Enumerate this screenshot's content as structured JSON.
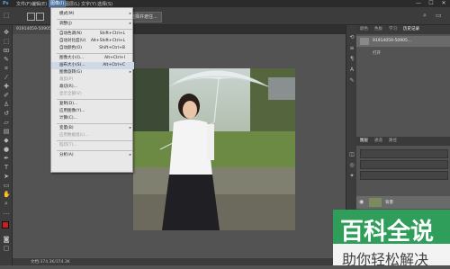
{
  "menubar": {
    "items": [
      {
        "label": "文件(F)",
        "active": false
      },
      {
        "label": "编辑(E)",
        "active": false
      },
      {
        "label": "图像(I)",
        "active": true
      },
      {
        "label": "图层(L)",
        "active": false
      },
      {
        "label": "文字(Y)",
        "active": false
      },
      {
        "label": "选择(S)",
        "active": false
      }
    ],
    "window_buttons": [
      "—",
      "☐",
      "✕"
    ]
  },
  "optbar": {
    "button_label": "选择并遮住..."
  },
  "document": {
    "tab_label": "91914059-50905..."
  },
  "image_menu": {
    "items": [
      {
        "label": "模式(M)",
        "shortcut": "",
        "submenu": true,
        "disabled": false
      },
      {
        "sep": true
      },
      {
        "label": "调整(J)",
        "shortcut": "",
        "submenu": true,
        "disabled": false
      },
      {
        "sep": true
      },
      {
        "label": "自动色调(N)",
        "shortcut": "Shift+Ctrl+L",
        "submenu": false,
        "disabled": false
      },
      {
        "label": "自动对比度(U)",
        "shortcut": "Alt+Shift+Ctrl+L",
        "submenu": false,
        "disabled": false
      },
      {
        "label": "自动颜色(O)",
        "shortcut": "Shift+Ctrl+B",
        "submenu": false,
        "disabled": false
      },
      {
        "sep": true
      },
      {
        "label": "图像大小(I)...",
        "shortcut": "Alt+Ctrl+I",
        "submenu": false,
        "disabled": false
      },
      {
        "label": "画布大小(S)...",
        "shortcut": "Alt+Ctrl+C",
        "submenu": false,
        "disabled": false,
        "highlight": true
      },
      {
        "label": "图像旋转(G)",
        "shortcut": "",
        "submenu": true,
        "disabled": false
      },
      {
        "label": "裁剪(P)",
        "shortcut": "",
        "submenu": false,
        "disabled": true
      },
      {
        "label": "裁切(R)...",
        "shortcut": "",
        "submenu": false,
        "disabled": false
      },
      {
        "label": "显示全部(V)",
        "shortcut": "",
        "submenu": false,
        "disabled": true
      },
      {
        "sep": true
      },
      {
        "label": "复制(D)...",
        "shortcut": "",
        "submenu": false,
        "disabled": false
      },
      {
        "label": "应用图像(Y)...",
        "shortcut": "",
        "submenu": false,
        "disabled": false
      },
      {
        "label": "计算(C)...",
        "shortcut": "",
        "submenu": false,
        "disabled": false
      },
      {
        "sep": true
      },
      {
        "label": "变量(B)",
        "shortcut": "",
        "submenu": true,
        "disabled": false
      },
      {
        "label": "应用数据组(L)...",
        "shortcut": "",
        "submenu": false,
        "disabled": true
      },
      {
        "sep": true
      },
      {
        "label": "陷印(T)...",
        "shortcut": "",
        "submenu": false,
        "disabled": true
      },
      {
        "sep": true
      },
      {
        "label": "分析(A)",
        "shortcut": "",
        "submenu": true,
        "disabled": false
      }
    ]
  },
  "history_panel": {
    "tabs": [
      "颜色",
      "色板",
      "学习",
      "历史记录"
    ],
    "entries": [
      {
        "label": "91914059-50905...",
        "selected": true
      },
      {
        "label": "打开",
        "selected": false
      },
      {
        "label": "",
        "selected": false
      },
      {
        "label": "",
        "selected": false
      },
      {
        "label": "",
        "selected": false
      }
    ]
  },
  "layers_panel": {
    "tabs": [
      "图层",
      "通道",
      "路径"
    ],
    "layer_name": "背景"
  },
  "status": {
    "text": "文档:374.3K/374.3K"
  },
  "watermark": {
    "line1": "百科全说",
    "line2": "助你轻松解决"
  },
  "colors": {
    "menu_bg": "#e8e8e8",
    "highlight": "#cfd9e6",
    "arrow": "#e02020",
    "watermark_bg": "#2f9e5a",
    "foreground_swatch": "#d11a1a"
  }
}
